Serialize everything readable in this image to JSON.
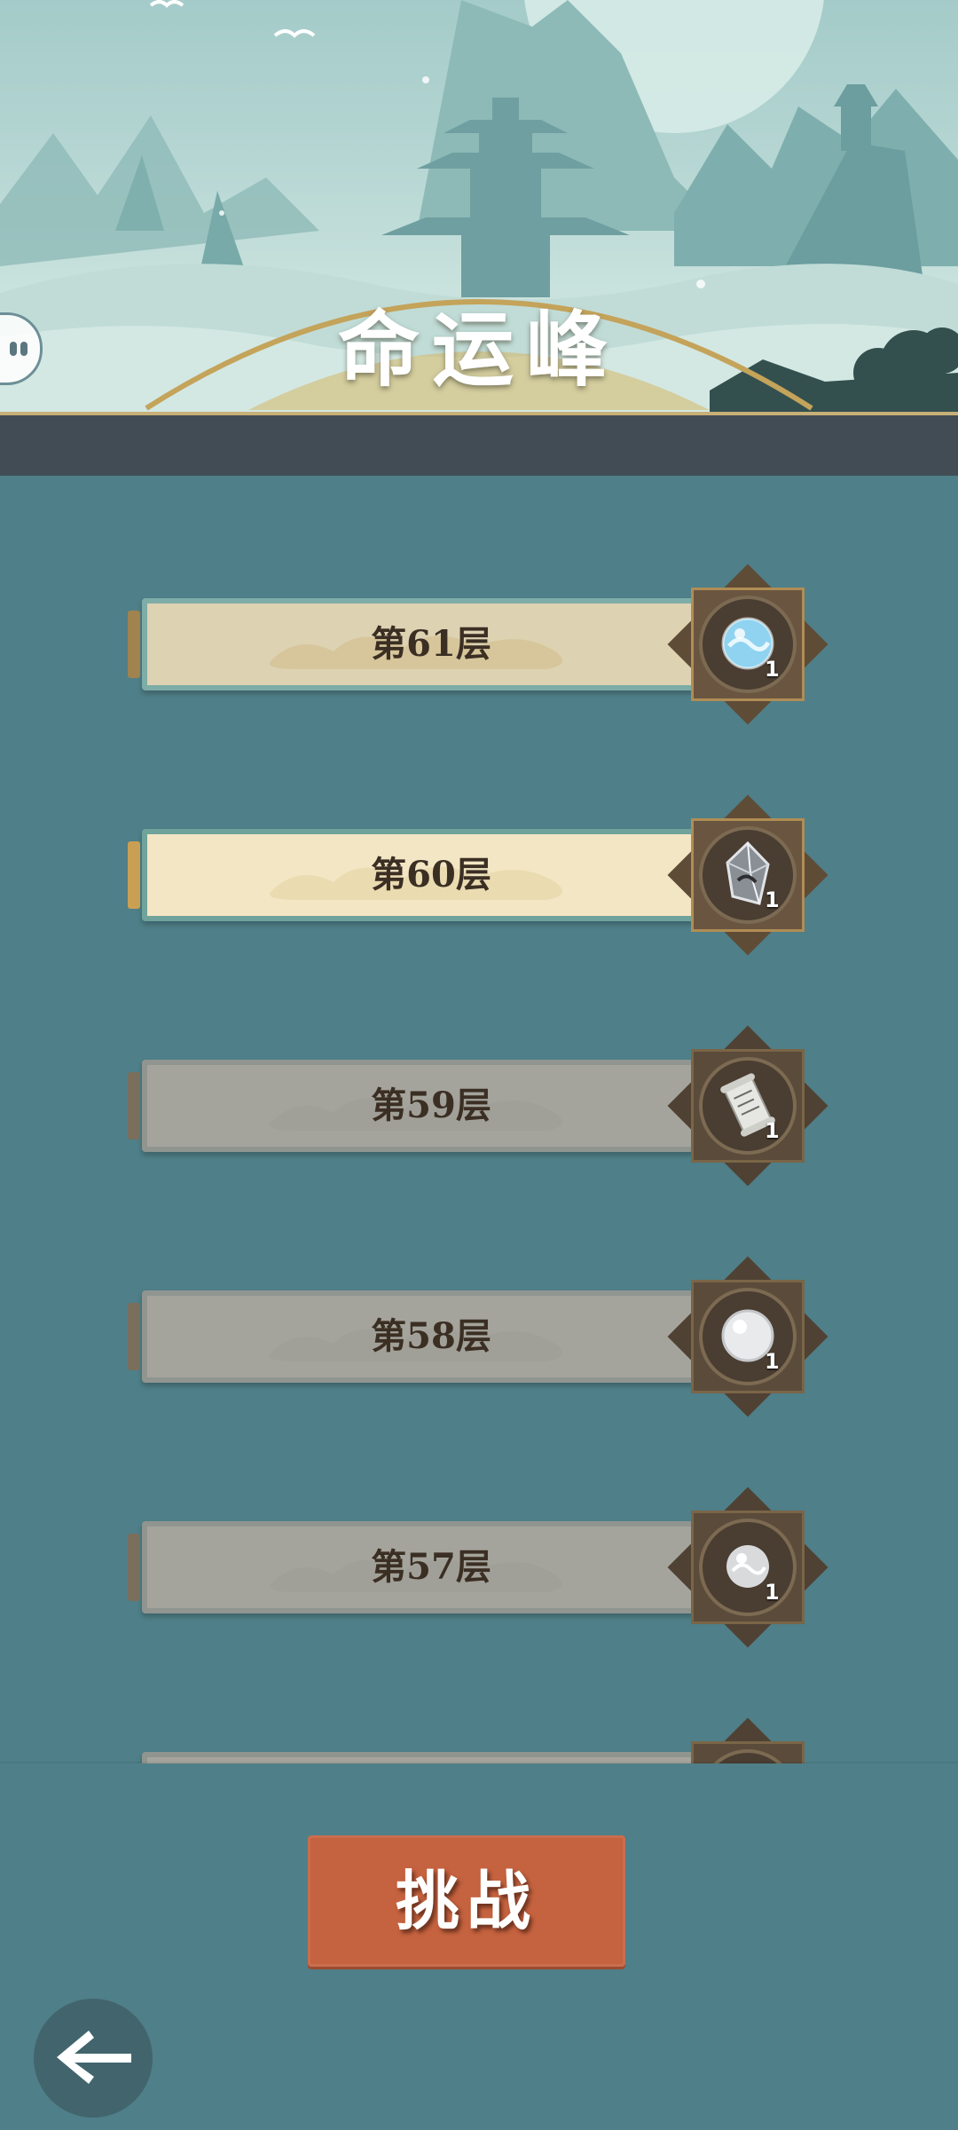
{
  "header": {
    "title": "命运峰"
  },
  "floors": [
    {
      "label": "第61层",
      "reward_icon": "blue-pearl-icon",
      "reward_count": "1",
      "state": "cleared"
    },
    {
      "label": "第60层",
      "reward_icon": "crystal-shard-icon",
      "reward_count": "1",
      "state": "current"
    },
    {
      "label": "第59层",
      "reward_icon": "scroll-icon",
      "reward_count": "1",
      "state": "locked"
    },
    {
      "label": "第58层",
      "reward_icon": "white-pearl-icon",
      "reward_count": "1",
      "state": "locked"
    },
    {
      "label": "第57层",
      "reward_icon": "silver-pearl-icon",
      "reward_count": "1",
      "state": "locked"
    }
  ],
  "actions": {
    "challenge_label": "挑战"
  },
  "colors": {
    "challenge_button": "#c5623f",
    "background": "#4f7f88",
    "header_band": "#424c55",
    "current_floor": "#f3e6c4"
  }
}
